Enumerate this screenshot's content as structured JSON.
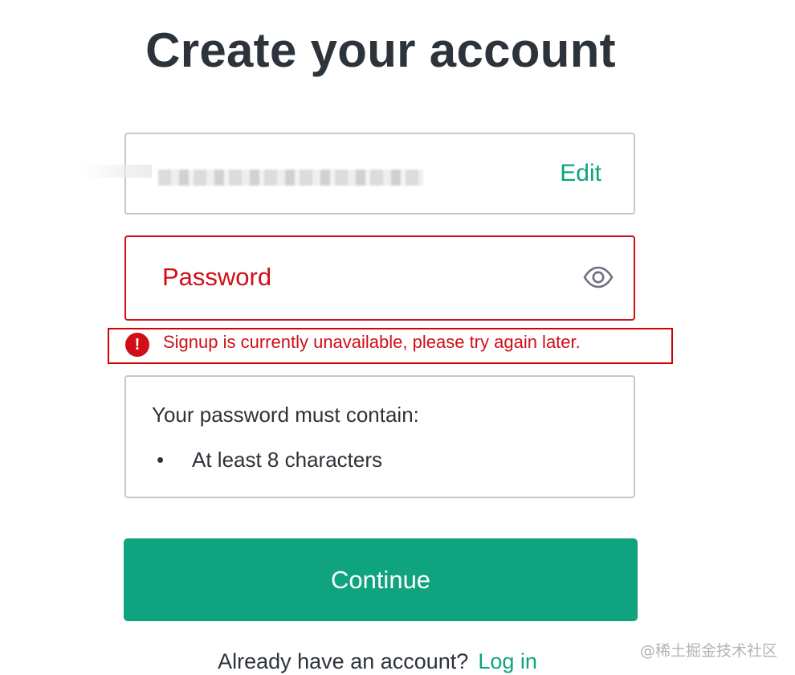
{
  "page": {
    "title": "Create your account"
  },
  "email_field": {
    "edit_label": "Edit"
  },
  "password_field": {
    "label": "Password",
    "toggle_icon": "eye-icon"
  },
  "error": {
    "icon": "!",
    "message": "Signup is currently unavailable, please try again later."
  },
  "requirements": {
    "heading": "Your password must contain:",
    "items": [
      {
        "bullet": "•",
        "text": "At least 8 characters"
      }
    ]
  },
  "actions": {
    "continue_label": "Continue"
  },
  "footer": {
    "prompt": "Already have an account?",
    "login_label": "Log in"
  },
  "watermark": {
    "text": "@稀土掘金技术社区"
  },
  "colors": {
    "accent": "#10a37f",
    "error": "#d00e17",
    "border": "#c2c8d0",
    "text": "#2d333a"
  }
}
